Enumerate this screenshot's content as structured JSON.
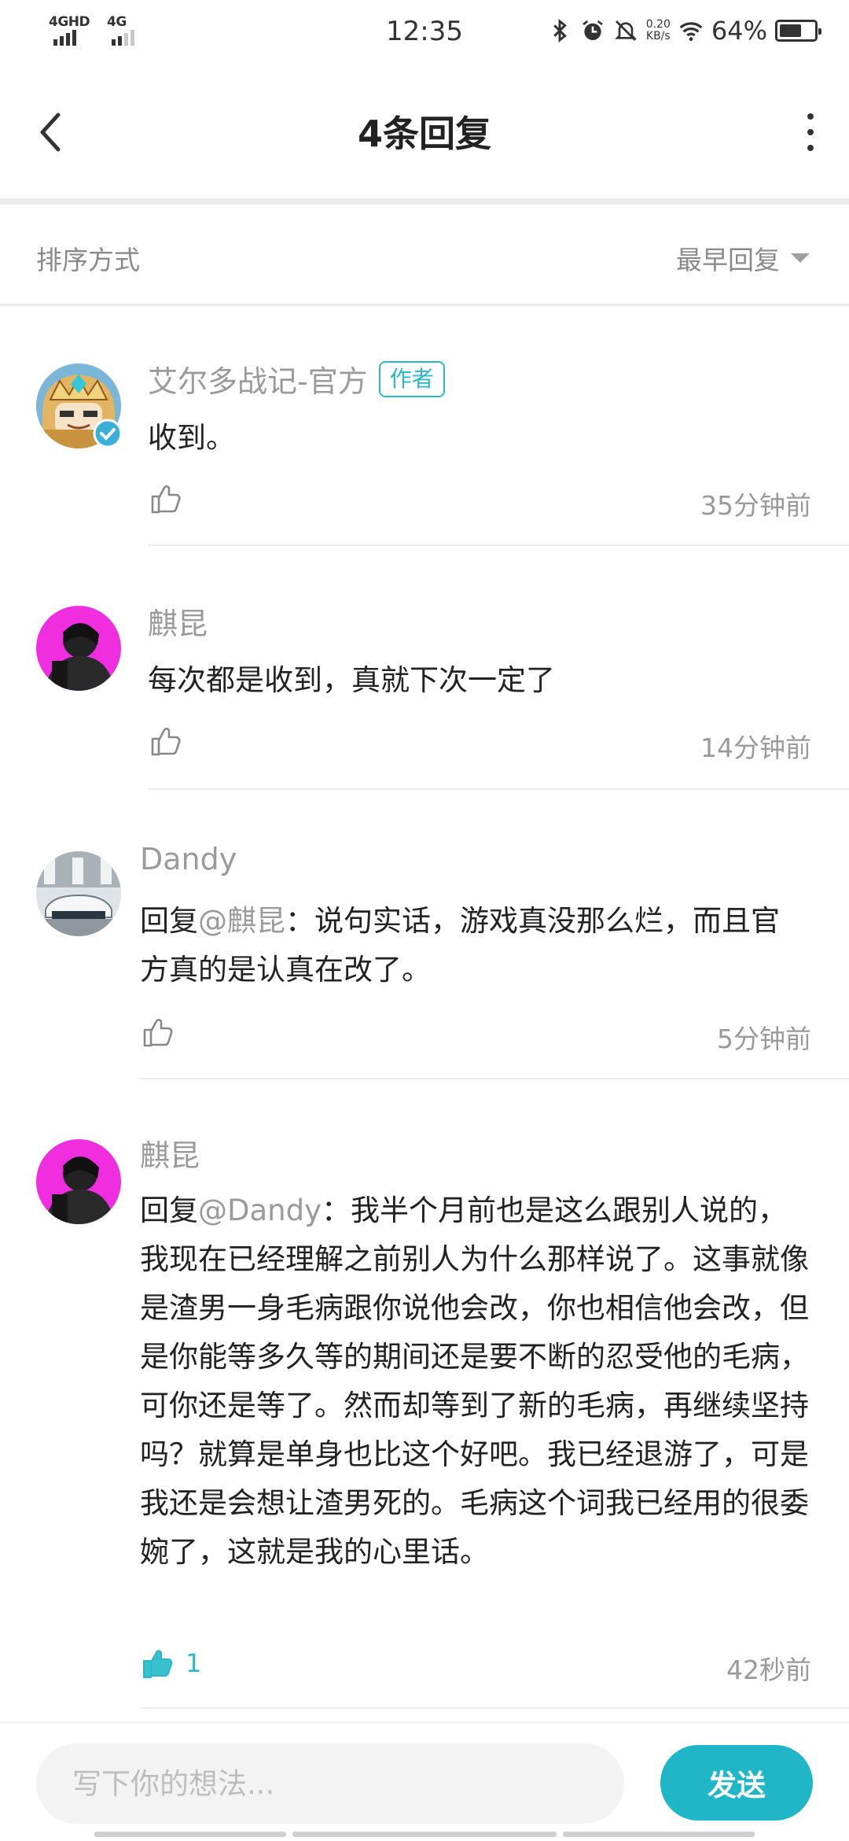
{
  "status_bar": {
    "network_1": "4GHD",
    "network_2": "4G",
    "time": "12:35",
    "speed_value": "0.20",
    "speed_unit": "KB/s",
    "battery_percent": "64%",
    "battery_level": 0.64
  },
  "header": {
    "title": "4条回复"
  },
  "sort": {
    "label": "排序方式",
    "selected": "最早回复"
  },
  "comments": [
    {
      "username": "艾尔多战记-官方",
      "badge": "作者",
      "text": "收到。",
      "time": "35分钟前",
      "likes": ""
    },
    {
      "username": "麒昆",
      "text": "每次都是收到，真就下次一定了",
      "time": "14分钟前",
      "likes": ""
    },
    {
      "username": "Dandy",
      "reply_prefix": "回复",
      "mention": "@麒昆",
      "text": "：说句实话，游戏真没那么烂，而且官方真的是认真在改了。",
      "time": "5分钟前",
      "likes": ""
    },
    {
      "username": "麒昆",
      "reply_prefix": "回复",
      "mention": "@Dandy",
      "text": "：我半个月前也是这么跟别人说的，我现在已经理解之前别人为什么那样说了。这事就像是渣男一身毛病跟你说他会改，你也相信他会改，但是你能等多久等的期间还是要不断的忍受他的毛病，可你还是等了。然而却等到了新的毛病，再继续坚持吗？就算是单身也比这个好吧。我已经退游了，可是我还是会想让渣男死的。毛病这个词我已经用的很委婉了，这就是我的心里话。",
      "time": "42秒前",
      "likes": "1"
    }
  ],
  "composer": {
    "placeholder": "写下你的想法...",
    "send_label": "发送"
  },
  "colors": {
    "accent": "#1fb7c7",
    "muted_text": "#9a9a9a",
    "body_text": "#222222"
  }
}
